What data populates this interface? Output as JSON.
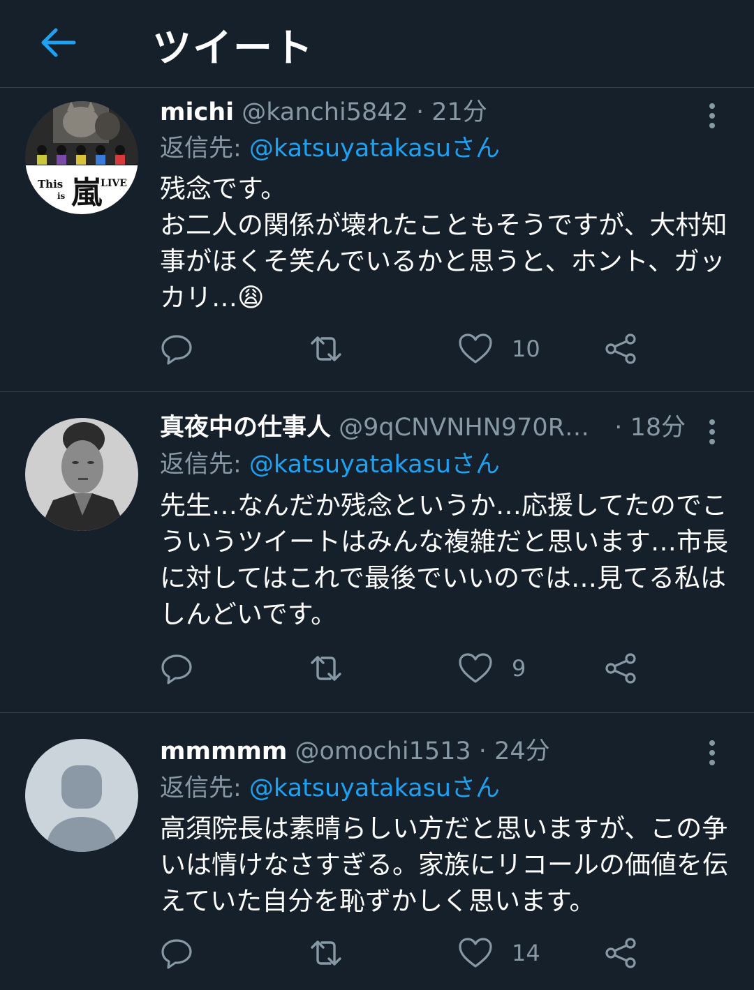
{
  "header": {
    "title": "ツイート"
  },
  "tweets": [
    {
      "name": "michi",
      "handle": "@kanchi5842",
      "dot": "·",
      "time": "21分",
      "reply_prefix": "返信先: ",
      "reply_mention": "@katsuyatakasu",
      "reply_suffix": "さん",
      "text": "残念です。\nお二人の関係が壊れたこともそうですが、大村知事がほくそ笑んでいるかと思うと、ホント、ガッカリ…😩",
      "like_count": "10",
      "avatar_text_left": "This",
      "avatar_text_small": "is",
      "avatar_text_right": "LIVE",
      "avatar_kanji": "嵐"
    },
    {
      "name": "真夜中の仕事人",
      "handle": "@9qCNVNHN970R…",
      "dot": "·",
      "time": "18分",
      "reply_prefix": "返信先: ",
      "reply_mention": "@katsuyatakasu",
      "reply_suffix": "さん",
      "text": "先生…なんだか残念というか…応援してたのでこういうツイートはみんな複雑だと思います…市長に対してはこれで最後でいいのでは…見てる私はしんどいです。",
      "like_count": "9"
    },
    {
      "name": "mmmmm",
      "handle": "@omochi1513",
      "dot": "·",
      "time": "24分",
      "reply_prefix": "返信先: ",
      "reply_mention": "@katsuyatakasu",
      "reply_suffix": "さん",
      "text": "高須院長は素晴らしい方だと思いますが、この争いは情けなさすぎる。家族にリコールの価値を伝えていた自分を恥ずかしく思います。",
      "like_count": "14"
    }
  ],
  "colors": {
    "background": "#15202b",
    "accent": "#1da1f2",
    "muted": "#8899a6",
    "divider": "#38444d"
  }
}
